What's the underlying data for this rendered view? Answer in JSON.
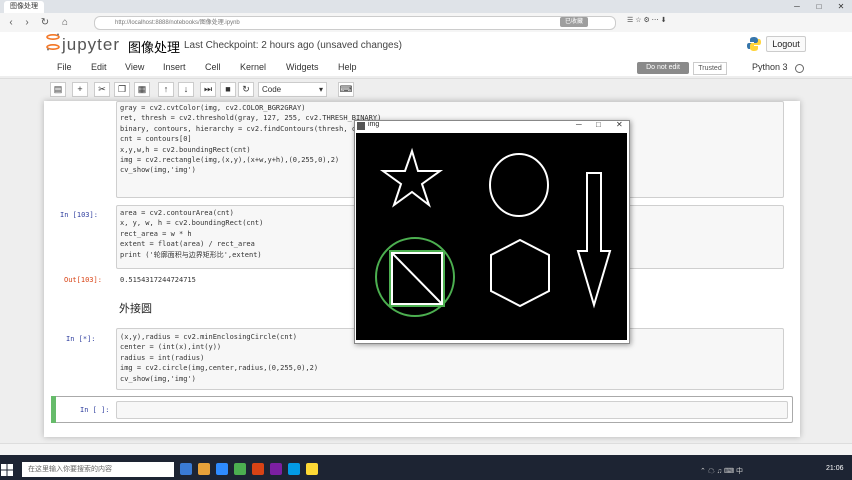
{
  "browser": {
    "tab_title": "图像处理",
    "url": "http://localhost:8888/notebooks/图像处理.ipynb",
    "right_label": "已收藏"
  },
  "header": {
    "logo_text": "jupyter",
    "notebook_name": "图像处理",
    "checkpoint": "Last Checkpoint: 2 hours ago (unsaved changes)",
    "logout": "Logout"
  },
  "menu": [
    "File",
    "Edit",
    "View",
    "Insert",
    "Cell",
    "Kernel",
    "Widgets",
    "Help"
  ],
  "kernel": {
    "status_badge": "Do not edit",
    "trusted": "Trusted",
    "name": "Python 3"
  },
  "toolbar": {
    "cell_type": "Code"
  },
  "cells": {
    "cell1": {
      "lines": [
        "gray = cv2.cvtColor(img, cv2.COLOR_BGR2GRAY)",
        "ret, thresh = cv2.threshold(gray, 127, 255, cv2.THRESH_BINARY)",
        "binary, contours, hierarchy = cv2.findContours(thresh, cv2.RETR_TREE, cv2.CHAIN_APPROX_NONE)",
        "cnt = contours[0]",
        "",
        "x,y,w,h = cv2.boundingRect(cnt)",
        "img = cv2.rectangle(img,(x,y),(x+w,y+h),(0,255,0),2)",
        "cv_show(img,'img')"
      ]
    },
    "cell2": {
      "prompt": "In [103]:",
      "lines": [
        "area = cv2.contourArea(cnt)",
        "x, y, w, h = cv2.boundingRect(cnt)",
        "rect_area = w * h",
        "extent = float(area) / rect_area",
        "print ('轮廓面积与边界矩形比',extent)"
      ],
      "out_prompt": "Out[103]:",
      "output": "0.5154317244724715"
    },
    "markdown": "外接圆",
    "cell3": {
      "prompt": "In [*]:",
      "lines": [
        "(x,y),radius = cv2.minEnclosingCircle(cnt)",
        "center = (int(x),int(y))",
        "radius = int(radius)",
        "img = cv2.circle(img,center,radius,(0,255,0),2)",
        "cv_show(img,'img')"
      ]
    },
    "cell4": {
      "prompt": "In [ ]:"
    }
  },
  "img_window": {
    "title": "img"
  },
  "taskbar": {
    "search_placeholder": "在这里输入你要搜索的内容",
    "time": "21:06"
  },
  "colors": {
    "green": "#4caf50",
    "selected_cell": "#66bb6a",
    "taskbar": "#1d2433"
  }
}
